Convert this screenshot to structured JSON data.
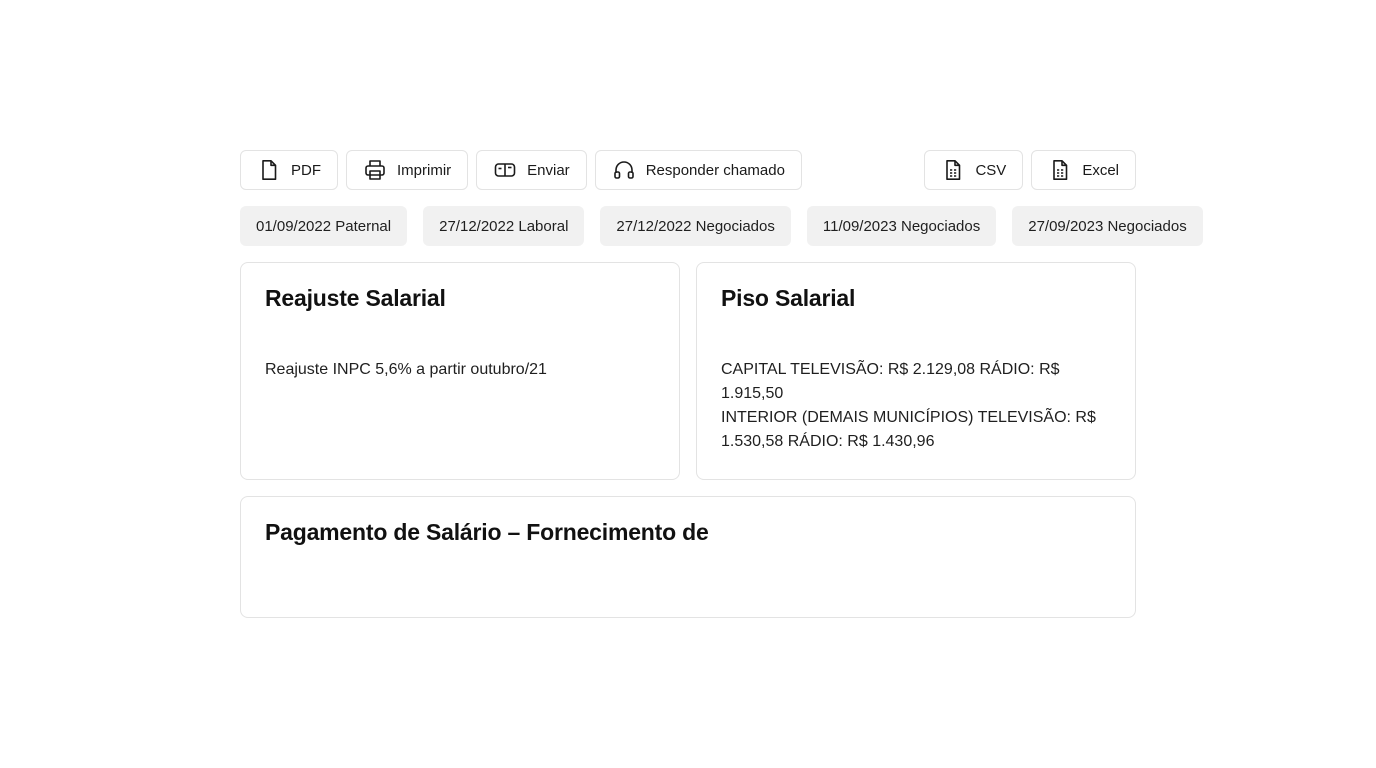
{
  "toolbar": {
    "left_buttons": [
      {
        "label": "PDF",
        "icon": "file-icon"
      },
      {
        "label": "Imprimir",
        "icon": "printer-icon"
      },
      {
        "label": "Enviar",
        "icon": "mailbox-icon"
      },
      {
        "label": "Responder chamado",
        "icon": "headphones-icon"
      }
    ],
    "right_buttons": [
      {
        "label": "CSV",
        "icon": "spreadsheet-icon"
      },
      {
        "label": "Excel",
        "icon": "spreadsheet-icon"
      }
    ]
  },
  "chips": [
    "01/09/2022 Paternal",
    "27/12/2022 Laboral",
    "27/12/2022 Negociados",
    "11/09/2023 Negociados",
    "27/09/2023 Negociados"
  ],
  "cards": {
    "reajuste": {
      "title": "Reajuste Salarial",
      "body": "Reajuste INPC 5,6% a partir outubro/21"
    },
    "piso": {
      "title": "Piso Salarial",
      "line1": "CAPITAL TELEVISÃO: R$ 2.129,08 RÁDIO: R$ 1.915,50",
      "line2": "INTERIOR (DEMAIS MUNICÍPIOS) TELEVISÃO: R$ 1.530,58 RÁDIO: R$ 1.430,96"
    },
    "pagamento": {
      "title": "Pagamento de Salário – Fornecimento de"
    }
  }
}
